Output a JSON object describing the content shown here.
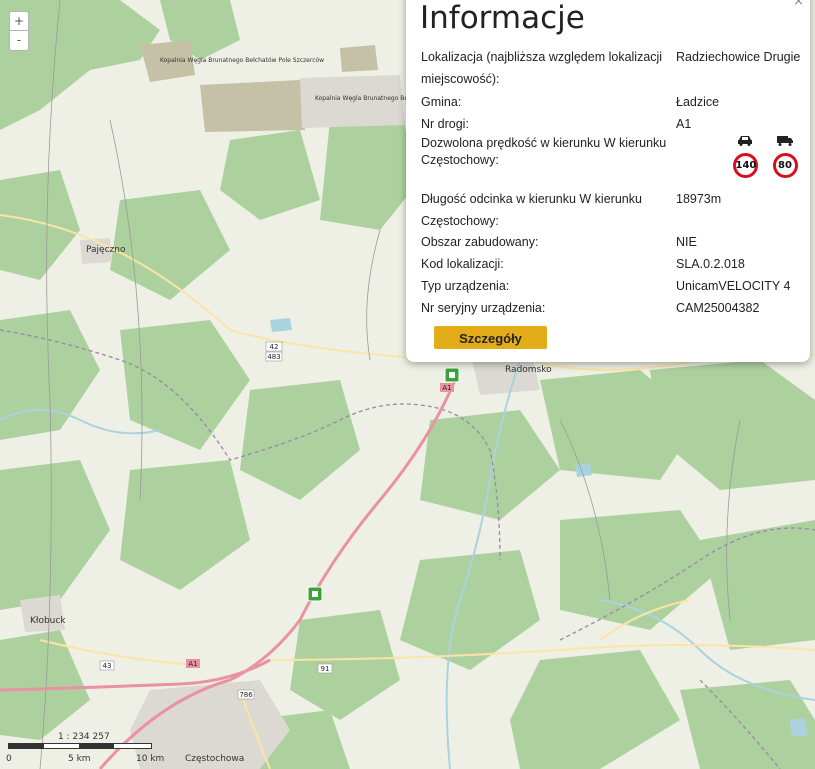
{
  "map": {
    "zoom_in": "+",
    "zoom_out": "-",
    "scale_ratio": "1 : 234 257",
    "scale_labels": [
      "0",
      "5 km",
      "10 km"
    ],
    "place_labels": [
      "Pajęczno",
      "Radomsko",
      "Kłobuck",
      "Częstochowa",
      "Kopalnia Węgla Brunatnego Bełchatów Pole Szczerców",
      "Kopalnia Węgla Brunatnego Bełchatów Pole Bełchatów"
    ],
    "road_shields": [
      "42",
      "483",
      "A1",
      "A1",
      "91",
      "43",
      "786"
    ],
    "colors": {
      "water": "#aad3df",
      "forest": "#add19e",
      "motorway": "#e892a2",
      "trunk": "#f9b29c",
      "secondary": "#fbe4a5",
      "mine": "#c5c1a6",
      "urban": "#dcd8d2",
      "camera": "#3aa43a"
    }
  },
  "popup": {
    "title": "Informacje",
    "close": "×",
    "location_label": "Lokalizacja (najbliższa względem lokalizacji miejscowość):",
    "location_value": "Radziechowice Drugie",
    "gmina_label": "Gmina:",
    "gmina_value": "Ładzice",
    "road_label": "Nr drogi:",
    "road_value": "A1",
    "speed_label": "Dozwolona prędkość w kierunku W kierunku Częstochowy:",
    "speed_car": "140",
    "speed_truck": "80",
    "car_icon": "car-icon",
    "truck_icon": "truck-icon",
    "length_label": "Długość odcinka w kierunku W kierunku Częstochowy:",
    "length_value": "18973m",
    "built_area_label": "Obszar zabudowany:",
    "built_area_value": "NIE",
    "code_label": "Kod lokalizacji:",
    "code_value": "SLA.0.2.018",
    "device_type_label": "Typ urządzenia:",
    "device_type_value": "UnicamVELOCITY 4",
    "serial_label": "Nr seryjny urządzenia:",
    "serial_value": "CAM25004382",
    "details_button": "Szczegóły"
  }
}
